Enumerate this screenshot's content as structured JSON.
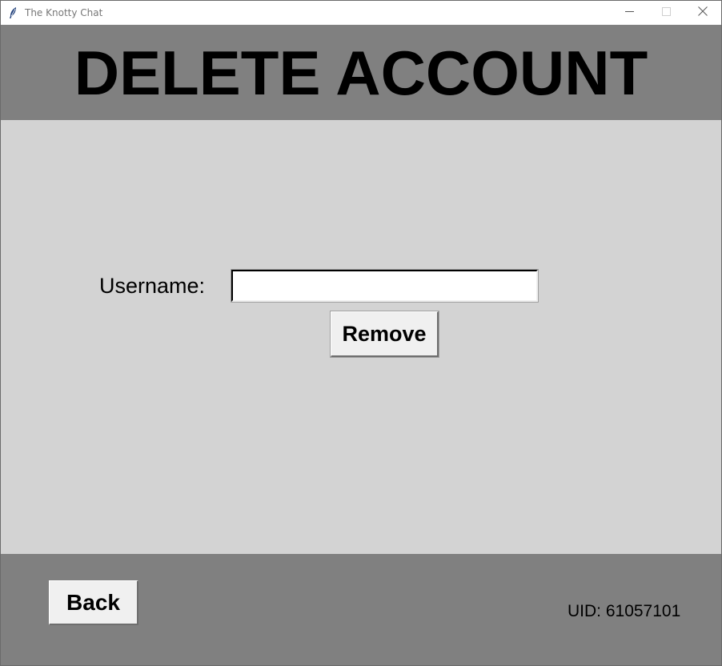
{
  "window": {
    "title": "The Knotty Chat",
    "app_icon": "feather-icon",
    "controls": [
      "minimize-icon",
      "maximize-icon",
      "close-icon"
    ]
  },
  "header": {
    "title": "DELETE ACCOUNT"
  },
  "form": {
    "username_label": "Username:",
    "username_value": "",
    "remove_label": "Remove"
  },
  "footer": {
    "back_label": "Back",
    "uid_text": "UID: 61057101"
  },
  "colors": {
    "header_bg": "#808080",
    "content_bg": "#d3d3d3",
    "footer_bg": "#808080",
    "button_bg": "#f0f0f0"
  }
}
